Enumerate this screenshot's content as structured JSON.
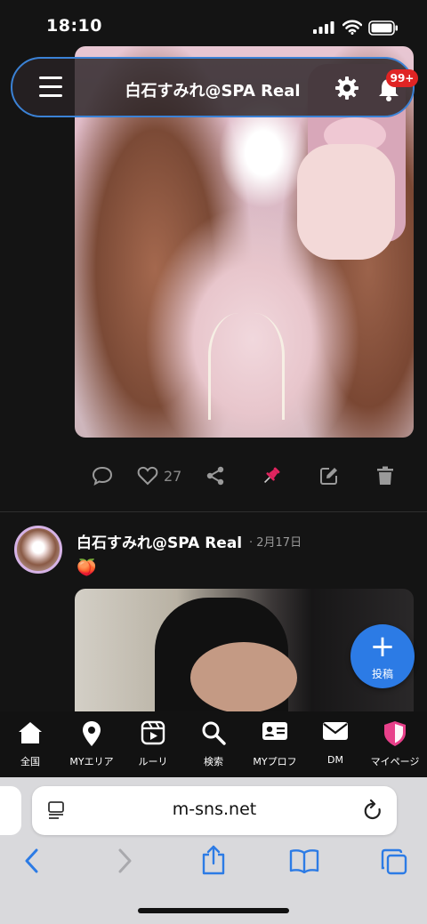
{
  "status_bar": {
    "time": "18:10"
  },
  "header": {
    "title": "白石すみれ@SPA Real",
    "notification_badge": "99+"
  },
  "post1": {
    "like_count": "27"
  },
  "post2": {
    "author": "白石すみれ@SPA Real",
    "date": "· 2月17日",
    "text": "🍑"
  },
  "fab": {
    "plus": "+",
    "label": "投稿"
  },
  "bottom_nav": {
    "items": [
      {
        "label": "全国",
        "icon": "home-icon"
      },
      {
        "label": "MYエリア",
        "icon": "map-pin-icon"
      },
      {
        "label": "ルーリ",
        "icon": "video-icon"
      },
      {
        "label": "検索",
        "icon": "search-icon"
      },
      {
        "label": "MYプロフ",
        "icon": "profile-card-icon"
      },
      {
        "label": "DM",
        "icon": "mail-icon"
      },
      {
        "label": "マイページ",
        "icon": "shield-icon"
      }
    ]
  },
  "browser": {
    "url": "m-sns.net"
  },
  "colors": {
    "accent": "#2c7be5",
    "badge": "#e02424",
    "pin": "#e0245e",
    "shield": "#e8408a"
  }
}
